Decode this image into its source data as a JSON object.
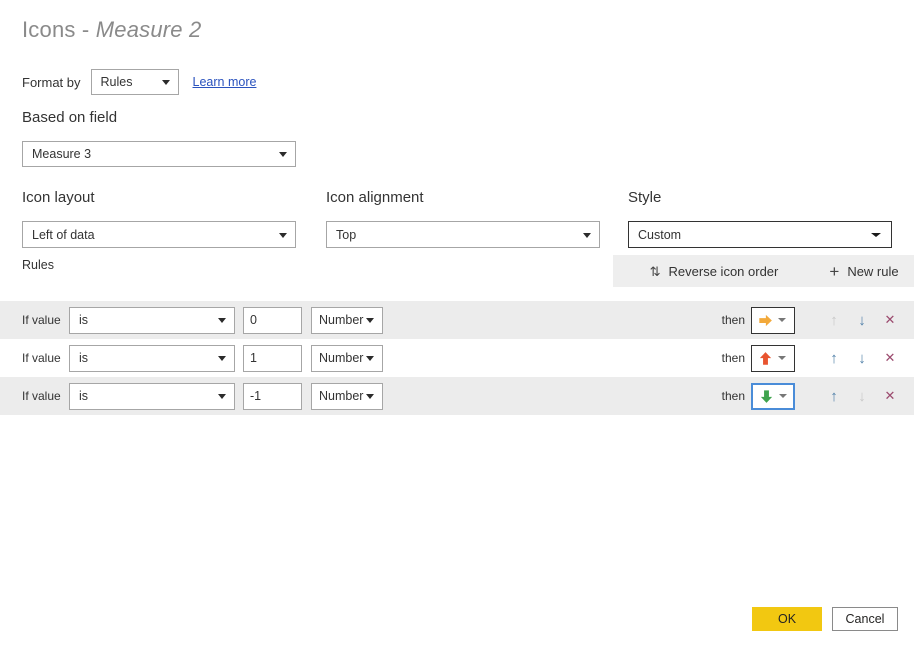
{
  "dialog": {
    "title_prefix": "Icons - ",
    "title_measure": "Measure 2"
  },
  "format_by": {
    "label": "Format by",
    "value": "Rules",
    "learn_more": "Learn more"
  },
  "based_on_field": {
    "label": "Based on field",
    "value": "Measure 3"
  },
  "icon_layout": {
    "label": "Icon layout",
    "value": "Left of data"
  },
  "icon_alignment": {
    "label": "Icon alignment",
    "value": "Top"
  },
  "style": {
    "label": "Style",
    "value": "Custom"
  },
  "rules_toolbar": {
    "rules_label": "Rules",
    "reverse_icon_order": "Reverse icon order",
    "reverse_icon_glyph": "⇅",
    "new_rule": "New rule",
    "new_rule_glyph": "+"
  },
  "rules": [
    {
      "if_label": "If value",
      "condition": "is",
      "value": "0",
      "type": "Number",
      "then_label": "then",
      "icon_name": "arrow-right-orange",
      "icon_color": "#F2A93B",
      "icon_direction": "right",
      "picker_focused": false,
      "move_up_enabled": false,
      "move_down_enabled": true
    },
    {
      "if_label": "If value",
      "condition": "is",
      "value": "1",
      "type": "Number",
      "then_label": "then",
      "icon_name": "arrow-up-red",
      "icon_color": "#E8542F",
      "icon_direction": "up",
      "picker_focused": false,
      "move_up_enabled": true,
      "move_down_enabled": true
    },
    {
      "if_label": "If value",
      "condition": "is",
      "value": "-1",
      "type": "Number",
      "then_label": "then",
      "icon_name": "arrow-down-green",
      "icon_color": "#3FA34D",
      "icon_direction": "down",
      "picker_focused": true,
      "move_up_enabled": true,
      "move_down_enabled": false
    }
  ],
  "row_actions": {
    "move_up": "↑",
    "move_down": "↓",
    "remove": "✕"
  },
  "footer": {
    "ok": "OK",
    "cancel": "Cancel"
  },
  "colors": {
    "accent_ok": "#F2C811",
    "link": "#2A52BE",
    "row_alt_bg": "#ECECEC",
    "focus_border": "#4A8CD8",
    "action_enabled": "#4F7FA8",
    "action_disabled": "#C8C8C8",
    "remove": "#9B4A6E"
  }
}
